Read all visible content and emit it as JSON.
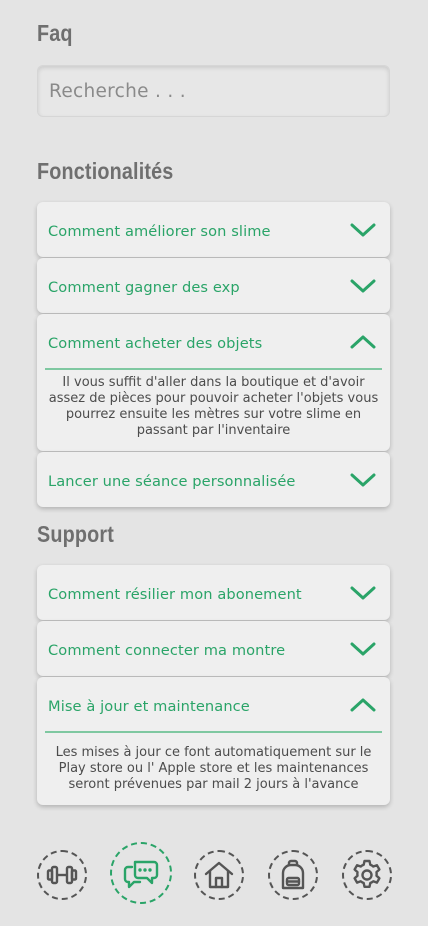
{
  "faq_title": "Faq",
  "search": {
    "placeholder": "Recherche . . ."
  },
  "sections": [
    {
      "title": "Fonctionalités",
      "items": [
        {
          "question": "Comment améliorer son slime",
          "expanded": false
        },
        {
          "question": "Comment gagner des exp",
          "expanded": false
        },
        {
          "question": "Comment acheter des objets",
          "expanded": true,
          "answer": "Il vous suffit d'aller dans la boutique et d'avoir assez de pièces pour pouvoir acheter l'objets vous pourrez ensuite les mètres sur votre slime en passant par l'inventaire"
        },
        {
          "question": "Lancer une séance personnalisée",
          "expanded": false
        }
      ]
    },
    {
      "title": "Support",
      "items": [
        {
          "question": "Comment résilier mon abonement",
          "expanded": false
        },
        {
          "question": "Comment connecter ma montre",
          "expanded": false
        },
        {
          "question": "Mise à jour et maintenance",
          "expanded": true,
          "answer": "Les mises à jour ce font automatiquement sur le Play store ou l' Apple store et les maintenances seront prévenues par mail 2 jours à l'avance"
        }
      ]
    }
  ],
  "nav": [
    {
      "icon": "dumbbell-icon",
      "active": false
    },
    {
      "icon": "chat-bubbles-icon",
      "active": true
    },
    {
      "icon": "home-icon",
      "active": false
    },
    {
      "icon": "backpack-icon",
      "active": false
    },
    {
      "icon": "gear-icon",
      "active": false
    }
  ],
  "colors": {
    "accent": "#2aa468",
    "background": "#e4e4e4",
    "card": "#efefef",
    "title": "#6f6f6f"
  }
}
